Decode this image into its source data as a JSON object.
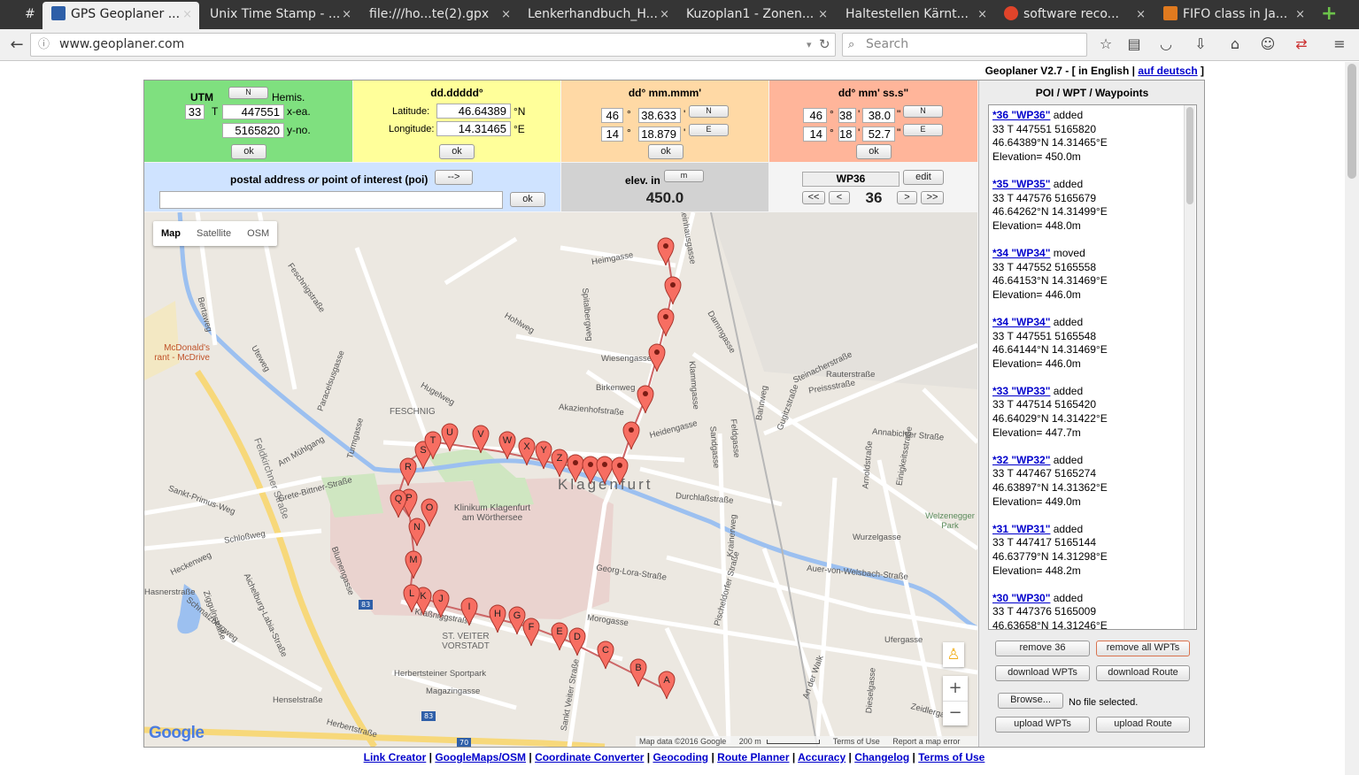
{
  "browser": {
    "tabs": [
      {
        "label": "#"
      },
      {
        "label": "GPS Geoplaner ..."
      },
      {
        "label": "Unix Time Stamp - ..."
      },
      {
        "label": "file:///ho...te(2).gpx"
      },
      {
        "label": "Lenkerhandbuch_H..."
      },
      {
        "label": "Kuzoplan1 - Zonen..."
      },
      {
        "label": "Haltestellen Kärnt..."
      },
      {
        "label": "software reco..."
      },
      {
        "label": "FIFO class in Ja..."
      }
    ],
    "url": "www.geoplaner.com",
    "search_placeholder": "Search",
    "close_glyph": "×",
    "new_tab_glyph": "+"
  },
  "header": {
    "app": "Geoplaner V2.7 - [ in English |",
    "lang_link": "auf deutsch",
    "close": "]"
  },
  "utm": {
    "title": "UTM",
    "hemis_label": "Hemis.",
    "zone": "33",
    "band": "T",
    "easting": "447551",
    "easting_label": "x-ea.",
    "northing": "5165820",
    "northing_label": "y-no.",
    "hemis_btn": "N",
    "ok": "ok"
  },
  "dd": {
    "title": "dd.ddddd°",
    "lat_label": "Latitude:",
    "lat": "46.64389",
    "lat_unit": "°N",
    "lon_label": "Longitude:",
    "lon": "14.31465",
    "lon_unit": "°E",
    "ok": "ok"
  },
  "dm": {
    "title": "dd° mm.mmm'",
    "lat_deg": "46",
    "lat_min": "38.633",
    "lon_deg": "14",
    "lon_min": "18.879",
    "deg": "°",
    "min": "'",
    "ns_btn": "N",
    "ew_btn": "E",
    "ok": "ok"
  },
  "dms": {
    "title": "dd° mm' ss.s\"",
    "lat_deg": "46",
    "lat_min": "38",
    "lat_sec": "38.0",
    "lon_deg": "14",
    "lon_min": "18",
    "lon_sec": "52.7",
    "deg": "°",
    "min": "'",
    "sec": "\"",
    "ns_btn": "N",
    "ew_btn": "E",
    "ok": "ok"
  },
  "address": {
    "title_a": "postal address",
    "title_or": "or",
    "title_b": "point of interest (poi)",
    "arrow_btn": "-->",
    "value": "",
    "ok": "ok"
  },
  "elev": {
    "title": "elev. in",
    "unit_btn": "m",
    "value": "450.0"
  },
  "wp_nav": {
    "name": "WP36",
    "edit": "edit",
    "first": "<<",
    "prev": "<",
    "number": "36",
    "next": ">",
    "last": ">>"
  },
  "map": {
    "types": [
      "Map",
      "Satellite",
      "OSM"
    ],
    "zoom_in": "+",
    "zoom_out": "−",
    "attribution": "Map data ©2016 Google",
    "scale": "200 m",
    "terms": "Terms of Use",
    "report": "Report a map error",
    "google": "Google",
    "city": "Klagenfurt",
    "hospital": "Klinikum Klagenfurt am Wörthersee",
    "district1": "FESCHNIG",
    "district2": "ST. VEITER VORSTADT",
    "labels": [
      "Heimgasse",
      "Feschnigstraße",
      "Hohlweg",
      "Spitalbergweg",
      "Wiesengasse",
      "Birkenweg",
      "Akazienhofstraße",
      "Heidengasse",
      "Durchlaßstraße",
      "Georg-Lora-Straße",
      "Morogasse",
      "Kraßniggstraße",
      "Herbertsteiner Sportpark",
      "Magazingasse",
      "Henselstraße",
      "Herbertstraße",
      "Feldkirchner Straße",
      "Grete-Bittner-Straße",
      "Blumengasse",
      "Schloßweg",
      "Sankt-Primus-Weg",
      "Zigguln­straße",
      "Turmgasse",
      "Hugelweg",
      "Paracelsusgasse",
      "Uteweg",
      "Am Mühlgang",
      "Bertaweg",
      "McDonald's rant - McDrive",
      "Pischeldorfer Straße",
      "Steinacherstraße",
      "Rauterstraße",
      "Preissstraße",
      "Annabichler Straße",
      "Wurzelgasse",
      "Auer-von-Welsbach-Straße",
      "Klammgasse",
      "Dammgasse",
      "Sandgasse",
      "Feldgasse",
      "Krainerweg",
      "Gugitzstraße",
      "Arnoldstraße",
      "Einigkeitsstraße",
      "Welzenegger Park",
      "Ufergasse",
      "An der Walk",
      "Diesel­gasse",
      "Sankt Veiter Straße",
      "Kleinhausgasse",
      "Bahnweg",
      "Aichelburg-Labia-Straße",
      "Schmalzbergweg",
      "Heckenweg",
      "Hasnerstraße",
      "Zeidlergasse"
    ],
    "route_markers": [
      "A",
      "B",
      "C",
      "D",
      "E",
      "F",
      "G",
      "H",
      "I",
      "J",
      "K",
      "L",
      "M",
      "N",
      "O",
      "P",
      "Q",
      "R",
      "S",
      "T",
      "U",
      "V",
      "W",
      "X",
      "Y",
      "Z"
    ],
    "highway_shields": [
      "83",
      "83",
      "70"
    ]
  },
  "side": {
    "title": "POI / WPT / Waypoints",
    "entries": [
      {
        "link": "*36 \"WP36\"",
        "action": "added",
        "utm": "33 T 447551 5165820",
        "dd": "46.64389°N 14.31465°E",
        "elev": "Elevation= 450.0m"
      },
      {
        "link": "*35 \"WP35\"",
        "action": "added",
        "utm": "33 T 447576 5165679",
        "dd": "46.64262°N 14.31499°E",
        "elev": "Elevation= 448.0m"
      },
      {
        "link": "*34 \"WP34\"",
        "action": "moved",
        "utm": "33 T 447552 5165558",
        "dd": "46.64153°N 14.31469°E",
        "elev": "Elevation= 446.0m"
      },
      {
        "link": "*34 \"WP34\"",
        "action": "added",
        "utm": "33 T 447551 5165548",
        "dd": "46.64144°N 14.31469°E",
        "elev": "Elevation= 446.0m"
      },
      {
        "link": "*33 \"WP33\"",
        "action": "added",
        "utm": "33 T 447514 5165420",
        "dd": "46.64029°N 14.31422°E",
        "elev": "Elevation= 447.7m"
      },
      {
        "link": "*32 \"WP32\"",
        "action": "added",
        "utm": "33 T 447467 5165274",
        "dd": "46.63897°N 14.31362°E",
        "elev": "Elevation= 449.0m"
      },
      {
        "link": "*31 \"WP31\"",
        "action": "added",
        "utm": "33 T 447417 5165144",
        "dd": "46.63779°N 14.31298°E",
        "elev": "Elevation= 448.2m"
      },
      {
        "link": "*30 \"WP30\"",
        "action": "added",
        "utm": "33 T 447376 5165009",
        "dd": "46.63658°N 14.31246°E",
        "elev": ""
      }
    ],
    "remove_one": "remove 36",
    "remove_all": "remove all WPTs",
    "download_wpts": "download WPTs",
    "download_route": "download Route",
    "browse": "Browse...",
    "no_file": "No file selected.",
    "upload_wpts": "upload WPTs",
    "upload_route": "upload Route"
  },
  "footer": {
    "links": [
      "Link Creator",
      "GoogleMaps/OSM",
      "Coordinate Converter",
      "Geocoding",
      "Route Planner",
      "Accuracy",
      "Changelog",
      "Terms of Use"
    ],
    "sep": " | "
  }
}
